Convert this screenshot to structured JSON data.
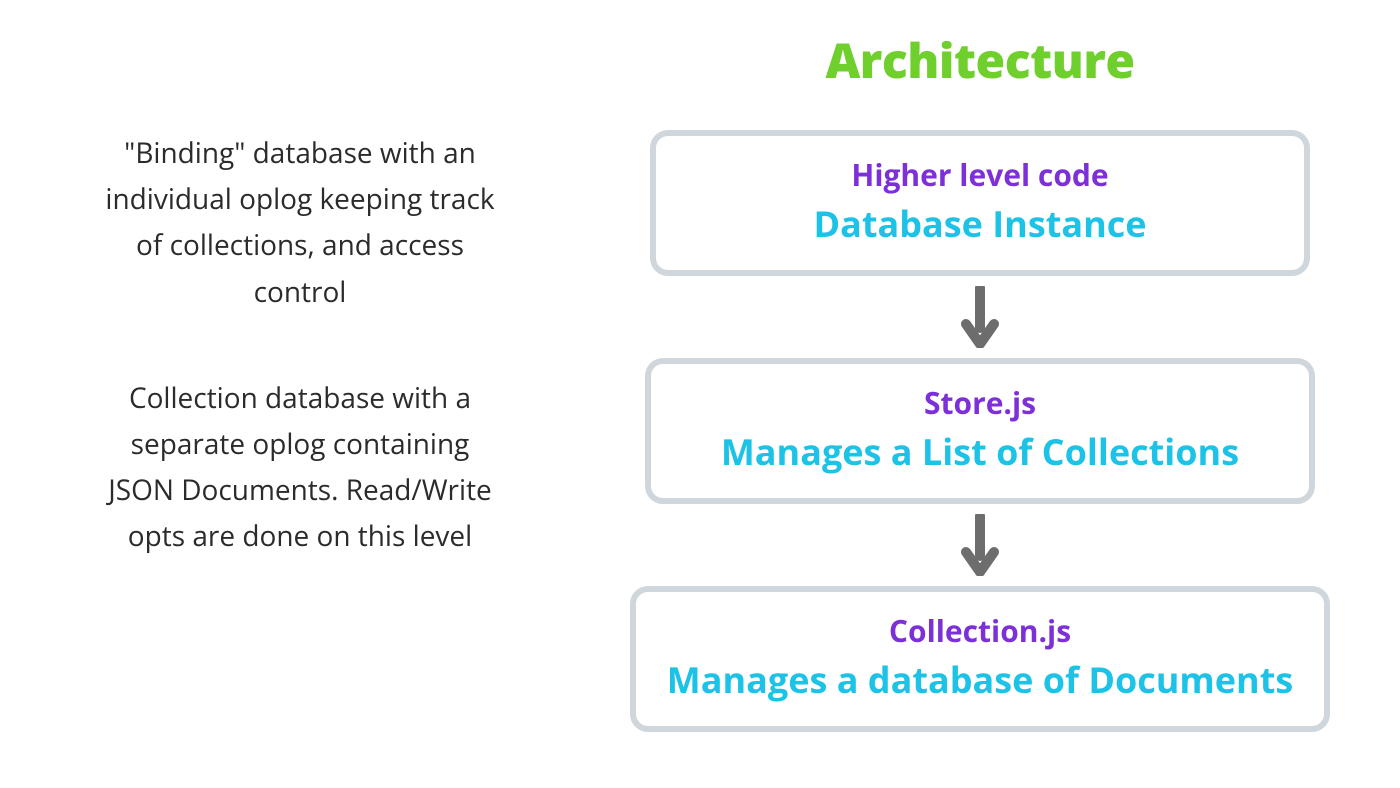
{
  "title": "Architecture",
  "descriptions": [
    "\"Binding\" database with an individual oplog keeping track of collections, and access control",
    "Collection database with a separate oplog containing JSON Documents. Read/Write opts are done on this level"
  ],
  "boxes": [
    {
      "line1": "Higher level code",
      "line2": "Database Instance"
    },
    {
      "line1": "Store.js",
      "line2": "Manages a List of Collections"
    },
    {
      "line1": "Collection.js",
      "line2": "Manages a database of Documents"
    }
  ],
  "colors": {
    "title": "#6fcf2d",
    "boxBorder": "#cfd7dc",
    "line1": "#7e30d8",
    "line2": "#1cc3e7",
    "arrow": "#6d6d6d"
  }
}
